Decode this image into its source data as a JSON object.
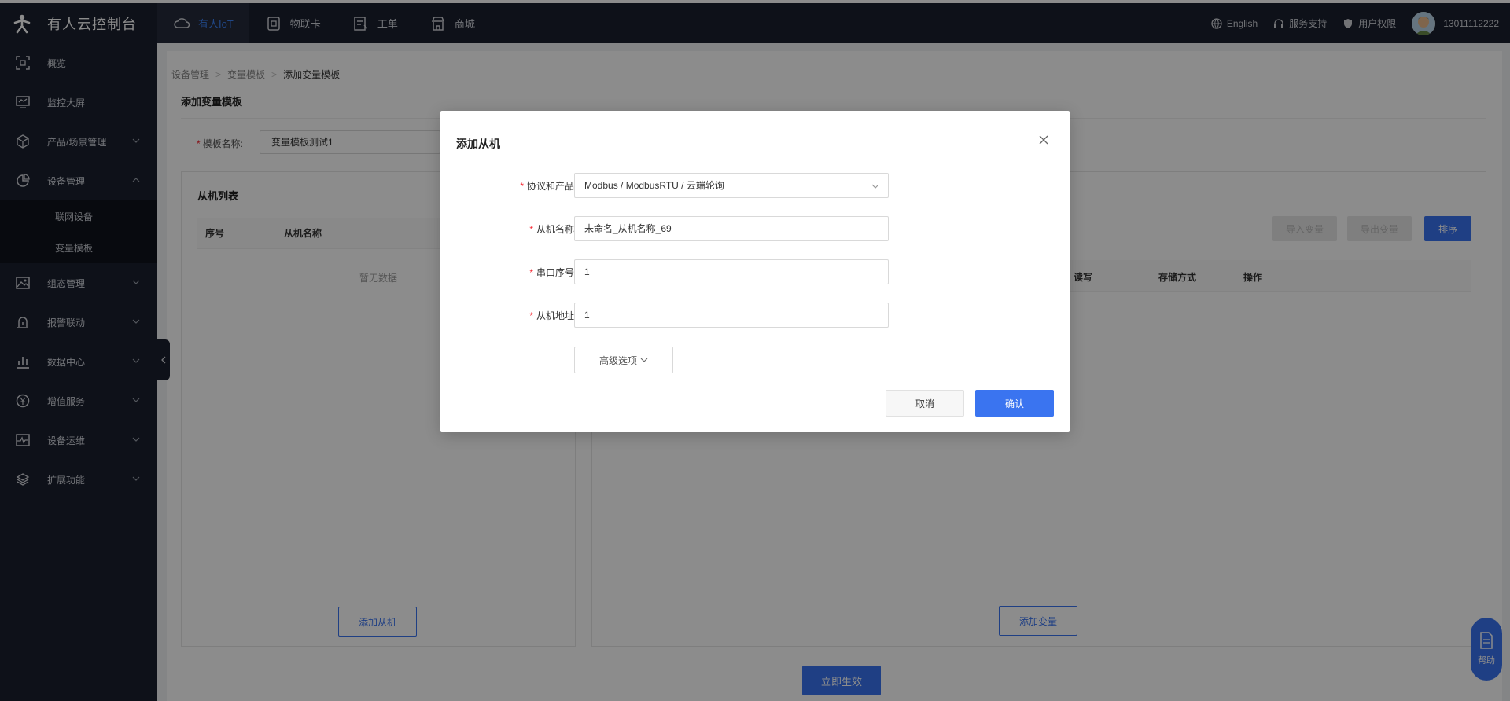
{
  "app": {
    "title": "有人云控制台"
  },
  "topnav": [
    {
      "label": "有人IoT",
      "icon": "cloud-icon",
      "active": true
    },
    {
      "label": "物联卡",
      "icon": "sim-card-icon",
      "active": false
    },
    {
      "label": "工单",
      "icon": "ticket-icon",
      "active": false
    },
    {
      "label": "商城",
      "icon": "store-icon",
      "active": false
    }
  ],
  "topright": {
    "language": "English",
    "support": "服务支持",
    "permissions": "用户权限",
    "user": "13011112222"
  },
  "sidebar": {
    "items": [
      {
        "label": "概览",
        "icon": "overview-icon"
      },
      {
        "label": "监控大屏",
        "icon": "monitor-icon"
      },
      {
        "label": "产品/场景管理",
        "icon": "cube-icon"
      },
      {
        "label": "设备管理",
        "icon": "pie-icon",
        "expanded": true
      },
      {
        "label": "组态管理",
        "icon": "image-icon"
      },
      {
        "label": "报警联动",
        "icon": "alarm-icon"
      },
      {
        "label": "数据中心",
        "icon": "bar-chart-icon"
      },
      {
        "label": "增值服务",
        "icon": "yen-icon"
      },
      {
        "label": "设备运维",
        "icon": "pulse-icon"
      },
      {
        "label": "扩展功能",
        "icon": "layers-icon"
      }
    ],
    "subitems": [
      "联网设备",
      "变量模板"
    ]
  },
  "breadcrumb": [
    "设备管理",
    "变量模板",
    "添加变量模板"
  ],
  "page": {
    "title": "添加变量模板",
    "template_name_label": "模板名称:",
    "template_name_value": "变量模板测试1"
  },
  "slave_panel": {
    "title": "从机列表",
    "columns": [
      "序号",
      "从机名称"
    ],
    "empty": "暂无数据",
    "add_button": "添加从机"
  },
  "var_panel": {
    "columns": [
      "读写",
      "存储方式",
      "操作"
    ],
    "import_button": "导入变量",
    "export_button": "导出变量",
    "sort_button": "排序",
    "add_button": "添加变量"
  },
  "apply_button": "立即生效",
  "help_label": "帮助",
  "modal": {
    "title": "添加从机",
    "fields": [
      {
        "label": "协议和产品",
        "value": "Modbus / ModbusRTU / 云端轮询",
        "type": "select"
      },
      {
        "label": "从机名称",
        "value": "未命名_从机名称_69",
        "type": "text"
      },
      {
        "label": "串口序号",
        "value": "1",
        "type": "text"
      },
      {
        "label": "从机地址",
        "value": "1",
        "type": "text"
      }
    ],
    "advanced": "高级选项",
    "cancel": "取消",
    "confirm": "确认"
  },
  "colors": {
    "primary": "#3a74f0",
    "sidebar_bg": "#1a1f2e",
    "required": "#f5222d"
  }
}
